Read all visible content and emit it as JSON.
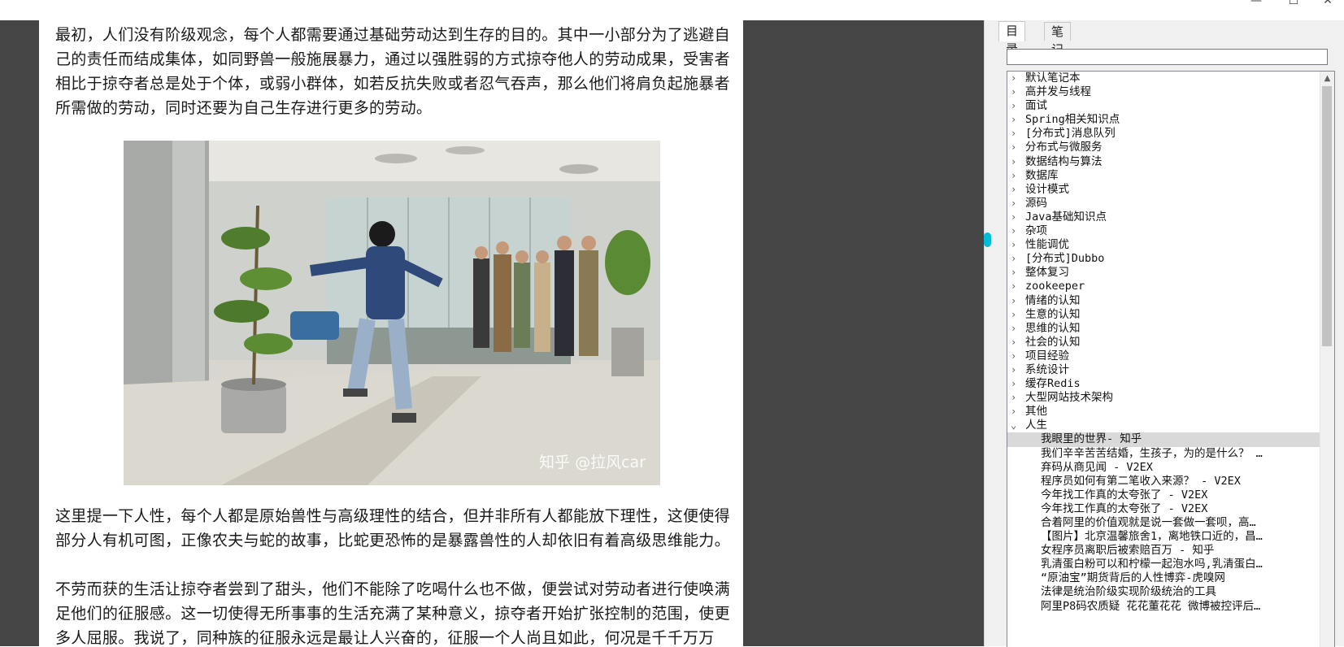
{
  "window": {
    "minimize": "—",
    "maximize": "☐",
    "close": "✕"
  },
  "article": {
    "p1": "最初，人们没有阶级观念，每个人都需要通过基础劳动达到生存的目的。其中一小部分为了逃避自己的责任而结成集体，如同野兽一般施展暴力，通过以强胜弱的方式掠夺他人的劳动成果，受害者相比于掠夺者总是处于个体，或弱小群体，如若反抗失败或者忍气吞声，那么他们将肩负起施暴者所需做的劳动，同时还要为自己生存进行更多的劳动。",
    "watermark": "知乎 @拉风car",
    "p2": "这里提一下人性，每个人都是原始兽性与高级理性的结合，但并非所有人都能放下理性，这便使得部分人有机可图，正像农夫与蛇的故事，比蛇更恐怖的是暴露兽性的人却依旧有着高级思维能力。",
    "p3": "不劳而获的生活让掠夺者尝到了甜头，他们不能除了吃喝什么也不做，便尝试对劳动者进行使唤满足他们的征服感。这一切使得无所事事的生活充满了某种意义，掠夺者开始扩张控制的范围，使更多人屈服。我说了，同种族的征服永远是最让人兴奋的，征服一个人尚且如此，何况是千千万万"
  },
  "sidebar": {
    "tabs": [
      {
        "label": "目录"
      },
      {
        "label": "笔记"
      }
    ],
    "search_value": "",
    "folders": [
      {
        "label": "默认笔记本"
      },
      {
        "label": "高并发与线程"
      },
      {
        "label": "面试"
      },
      {
        "label": "Spring相关知识点"
      },
      {
        "label": "[分布式]消息队列"
      },
      {
        "label": "分布式与微服务"
      },
      {
        "label": "数据结构与算法"
      },
      {
        "label": "数据库"
      },
      {
        "label": "设计模式"
      },
      {
        "label": "源码"
      },
      {
        "label": "Java基础知识点"
      },
      {
        "label": "杂项"
      },
      {
        "label": "性能调优"
      },
      {
        "label": "[分布式]Dubbo"
      },
      {
        "label": "整体复习"
      },
      {
        "label": "zookeeper"
      },
      {
        "label": "情绪的认知"
      },
      {
        "label": "生意的认知"
      },
      {
        "label": "思维的认知"
      },
      {
        "label": "社会的认知"
      },
      {
        "label": "项目经验"
      },
      {
        "label": "系统设计"
      },
      {
        "label": "缓存Redis"
      },
      {
        "label": "大型网站技术架构"
      },
      {
        "label": "其他"
      }
    ],
    "open_folder": {
      "label": "人生"
    },
    "notes": [
      {
        "label": "我眼里的世界- 知乎"
      },
      {
        "label": "我们辛辛苦苦结婚，生孩子，为的是什么？ …"
      },
      {
        "label": "弃码从商见闻 - V2EX"
      },
      {
        "label": "程序员如何有第二笔收入来源？ - V2EX"
      },
      {
        "label": "今年找工作真的太夸张了 - V2EX"
      },
      {
        "label": "今年找工作真的太夸张了 - V2EX"
      },
      {
        "label": "合着阿里的价值观就是说一套做一套呗，高…"
      },
      {
        "label": "【图片】北京温馨旅舍1，离地铁口近的，昌…"
      },
      {
        "label": "女程序员离职后被索赔百万 - 知乎"
      },
      {
        "label": "乳清蛋白粉可以和柠檬一起泡水吗,乳清蛋白…"
      },
      {
        "label": "“原油宝”期货背后的人性博弈-虎嗅网"
      },
      {
        "label": "法律是统治阶级实现阶级统治的工具"
      },
      {
        "label": "阿里P8码农质疑 花花董花花 微博被控评后…"
      }
    ]
  }
}
